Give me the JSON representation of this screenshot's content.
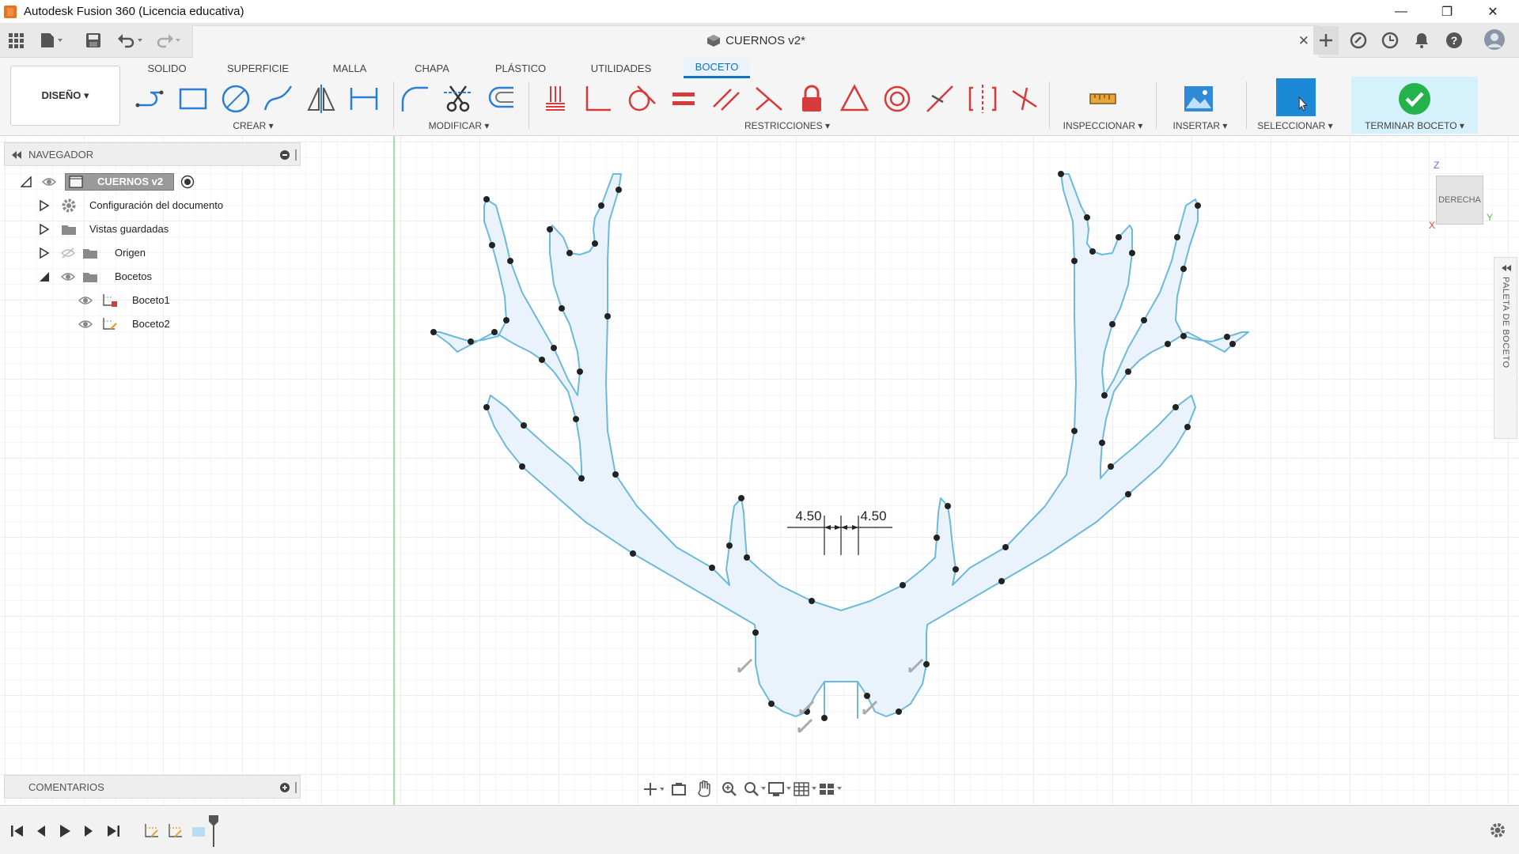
{
  "window": {
    "title": "Autodesk Fusion 360 (Licencia educativa)",
    "controls": {
      "minimize": "—",
      "restore": "❐",
      "close": "✕"
    }
  },
  "document": {
    "tab_title": "CUERNOS v2*",
    "close_glyph": "✕"
  },
  "ribbon": {
    "workspace": "DISEÑO ▾",
    "tabs": [
      {
        "label": "SOLIDO"
      },
      {
        "label": "SUPERFICIE"
      },
      {
        "label": "MALLA"
      },
      {
        "label": "CHAPA"
      },
      {
        "label": "PLÁSTICO"
      },
      {
        "label": "UTILIDADES"
      },
      {
        "label": "BOCETO"
      }
    ],
    "groups": {
      "crear": "CREAR ▾",
      "modificar": "MODIFICAR ▾",
      "restricciones": "RESTRICCIONES ▾",
      "inspeccionar": "INSPECCIONAR ▾",
      "insertar": "INSERTAR ▾",
      "seleccionar": "SELECCIONAR ▾",
      "terminar": "TERMINAR BOCETO ▾"
    }
  },
  "browser": {
    "title": "NAVEGADOR",
    "root": "CUERNOS v2",
    "items": [
      {
        "label": "Configuración del documento"
      },
      {
        "label": "Vistas guardadas"
      },
      {
        "label": "Origen"
      },
      {
        "label": "Bocetos"
      },
      {
        "label": "Boceto1"
      },
      {
        "label": "Boceto2"
      }
    ]
  },
  "comments": {
    "title": "COMENTARIOS"
  },
  "viewcube": {
    "face": "DERECHA",
    "axis_z": "Z",
    "axis_y": "Y",
    "axis_x": "X"
  },
  "palette": {
    "label": "PALETA DE BOCETO"
  },
  "sketch": {
    "dimensions": [
      {
        "value": "4.50"
      },
      {
        "value": "4.50"
      }
    ],
    "colors": {
      "profile_fill": "#eaf3fb",
      "line": "#6cb9dc",
      "point": "#222222",
      "origin_axis": "#7fdc7f"
    }
  }
}
